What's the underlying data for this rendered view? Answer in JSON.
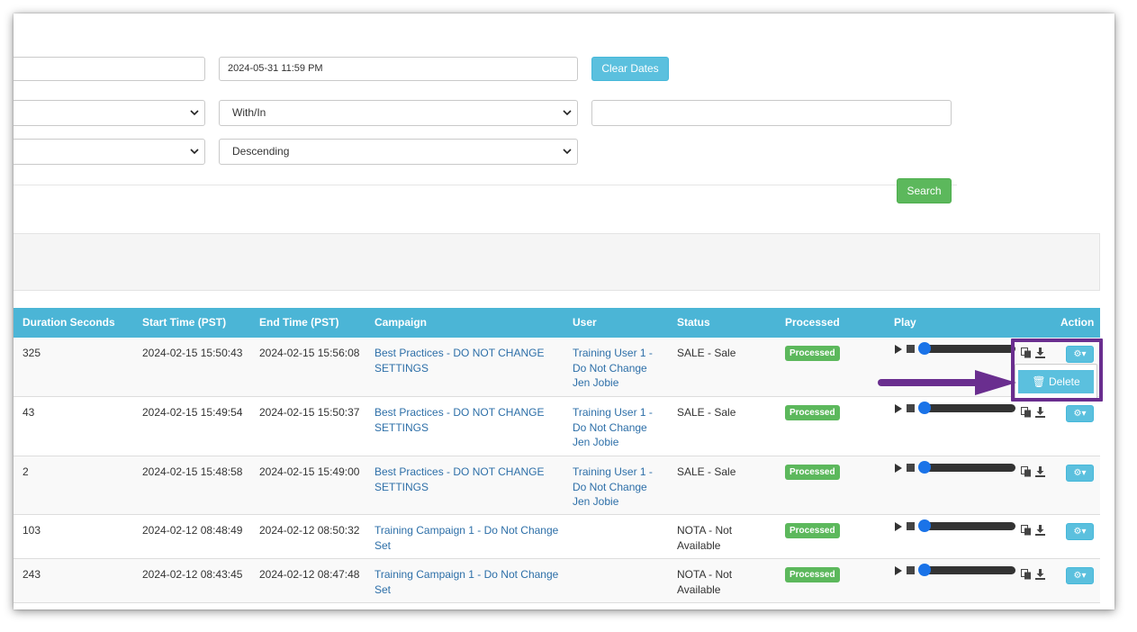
{
  "filters": {
    "end_date": "2024-05-31 11:59 PM",
    "clear_dates_label": "Clear Dates",
    "match_type": "With/In",
    "sort_order": "Descending",
    "search_label": "Search"
  },
  "table": {
    "headers": [
      "Duration Seconds",
      "Start Time (PST)",
      "End Time (PST)",
      "Campaign",
      "User",
      "Status",
      "Processed",
      "Play",
      "Action"
    ],
    "rows": [
      {
        "duration": "325",
        "start": "2024-02-15 15:50:43",
        "end": "2024-02-15 15:56:08",
        "campaign_l1": "Best Practices - DO NOT CHANGE",
        "campaign_l2": "SETTINGS",
        "user_l1": "Training User 1 -",
        "user_l2": "Do Not Change",
        "user_l3": "Jen Jobie",
        "status_l1": "SALE - Sale",
        "status_l2": "",
        "processed": "Processed"
      },
      {
        "duration": "43",
        "start": "2024-02-15 15:49:54",
        "end": "2024-02-15 15:50:37",
        "campaign_l1": "Best Practices - DO NOT CHANGE",
        "campaign_l2": "SETTINGS",
        "user_l1": "Training User 1 -",
        "user_l2": "Do Not Change",
        "user_l3": "Jen Jobie",
        "status_l1": "SALE - Sale",
        "status_l2": "",
        "processed": "Processed"
      },
      {
        "duration": "2",
        "start": "2024-02-15 15:48:58",
        "end": "2024-02-15 15:49:00",
        "campaign_l1": "Best Practices - DO NOT CHANGE",
        "campaign_l2": "SETTINGS",
        "user_l1": "Training User 1 -",
        "user_l2": "Do Not Change",
        "user_l3": "Jen Jobie",
        "status_l1": "SALE - Sale",
        "status_l2": "",
        "processed": "Processed"
      },
      {
        "duration": "103",
        "start": "2024-02-12 08:48:49",
        "end": "2024-02-12 08:50:32",
        "campaign_l1": "Training Campaign 1 - Do Not Change",
        "campaign_l2": "Set",
        "user_l1": "",
        "user_l2": "",
        "user_l3": "",
        "status_l1": "NOTA - Not",
        "status_l2": "Available",
        "processed": "Processed"
      },
      {
        "duration": "243",
        "start": "2024-02-12 08:43:45",
        "end": "2024-02-12 08:47:48",
        "campaign_l1": "Training Campaign 1 - Do Not Change",
        "campaign_l2": "Set",
        "user_l1": "",
        "user_l2": "",
        "user_l3": "",
        "status_l1": "NOTA - Not",
        "status_l2": "Available",
        "processed": "Processed"
      }
    ]
  },
  "action_menu": {
    "delete_label": "Delete"
  },
  "colors": {
    "header_bg": "#4bb5d6",
    "link": "#2d6fa8",
    "processed_badge": "#5cb85c",
    "annotation": "#6a2e8f"
  }
}
